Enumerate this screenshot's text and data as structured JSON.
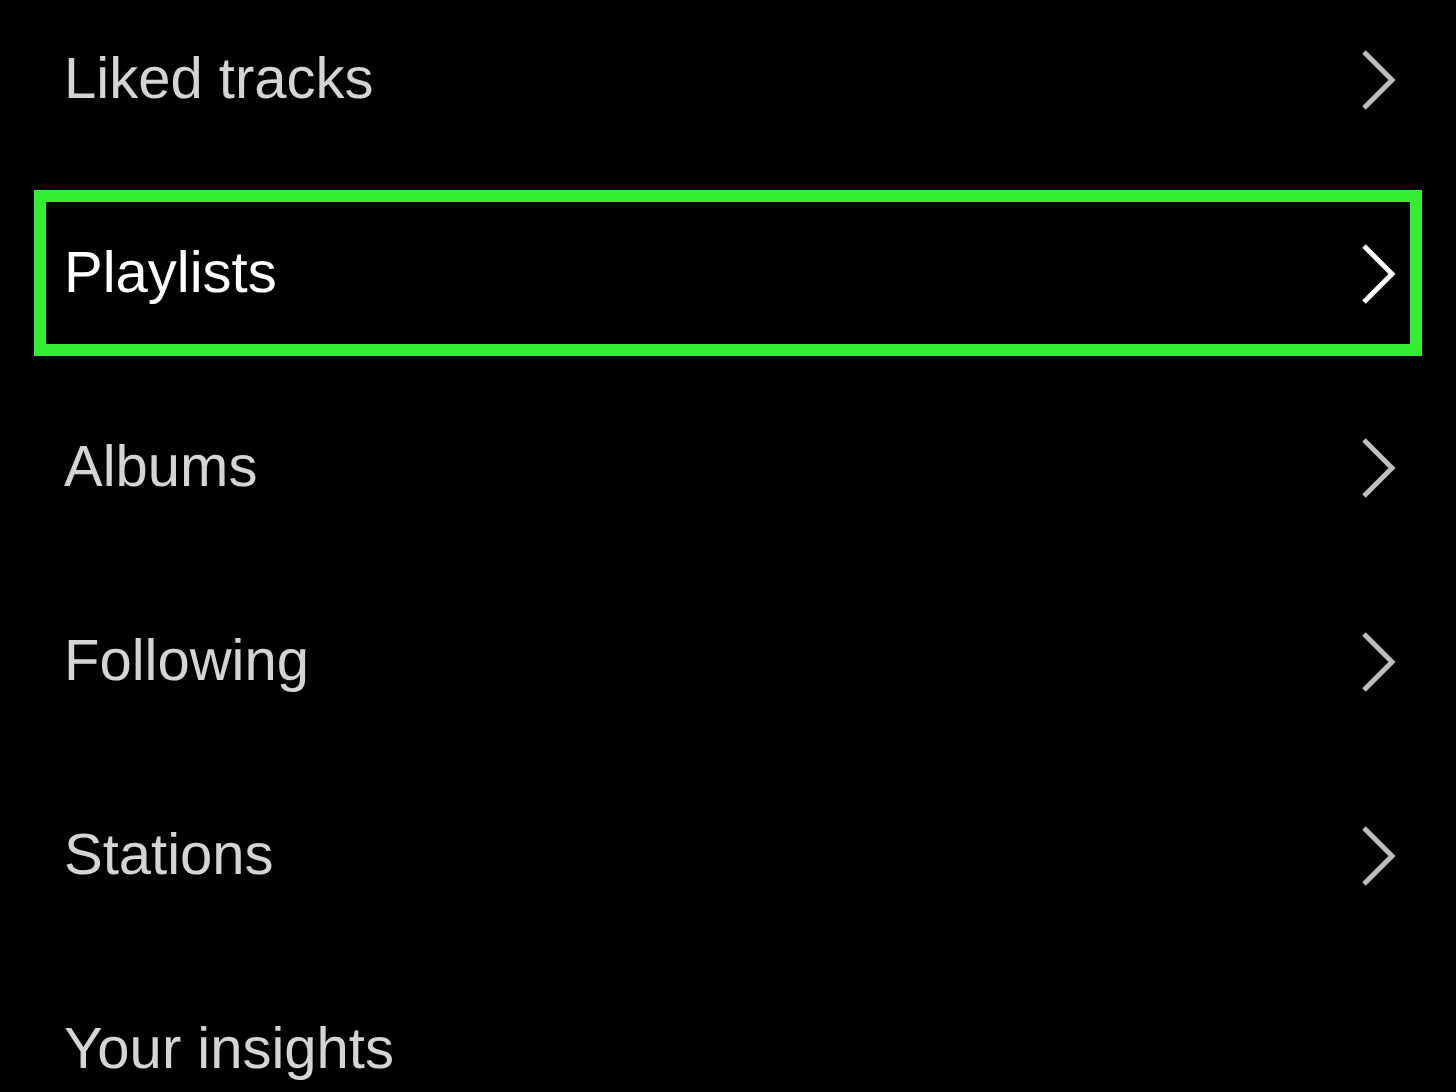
{
  "menu": {
    "items": [
      {
        "label": "Liked tracks",
        "highlighted": false,
        "chevron": true
      },
      {
        "label": "Playlists",
        "highlighted": true,
        "chevron": true
      },
      {
        "label": "Albums",
        "highlighted": false,
        "chevron": true
      },
      {
        "label": "Following",
        "highlighted": false,
        "chevron": true
      },
      {
        "label": "Stations",
        "highlighted": false,
        "chevron": true
      },
      {
        "label": "Your insights",
        "highlighted": false,
        "chevron": false
      }
    ]
  }
}
